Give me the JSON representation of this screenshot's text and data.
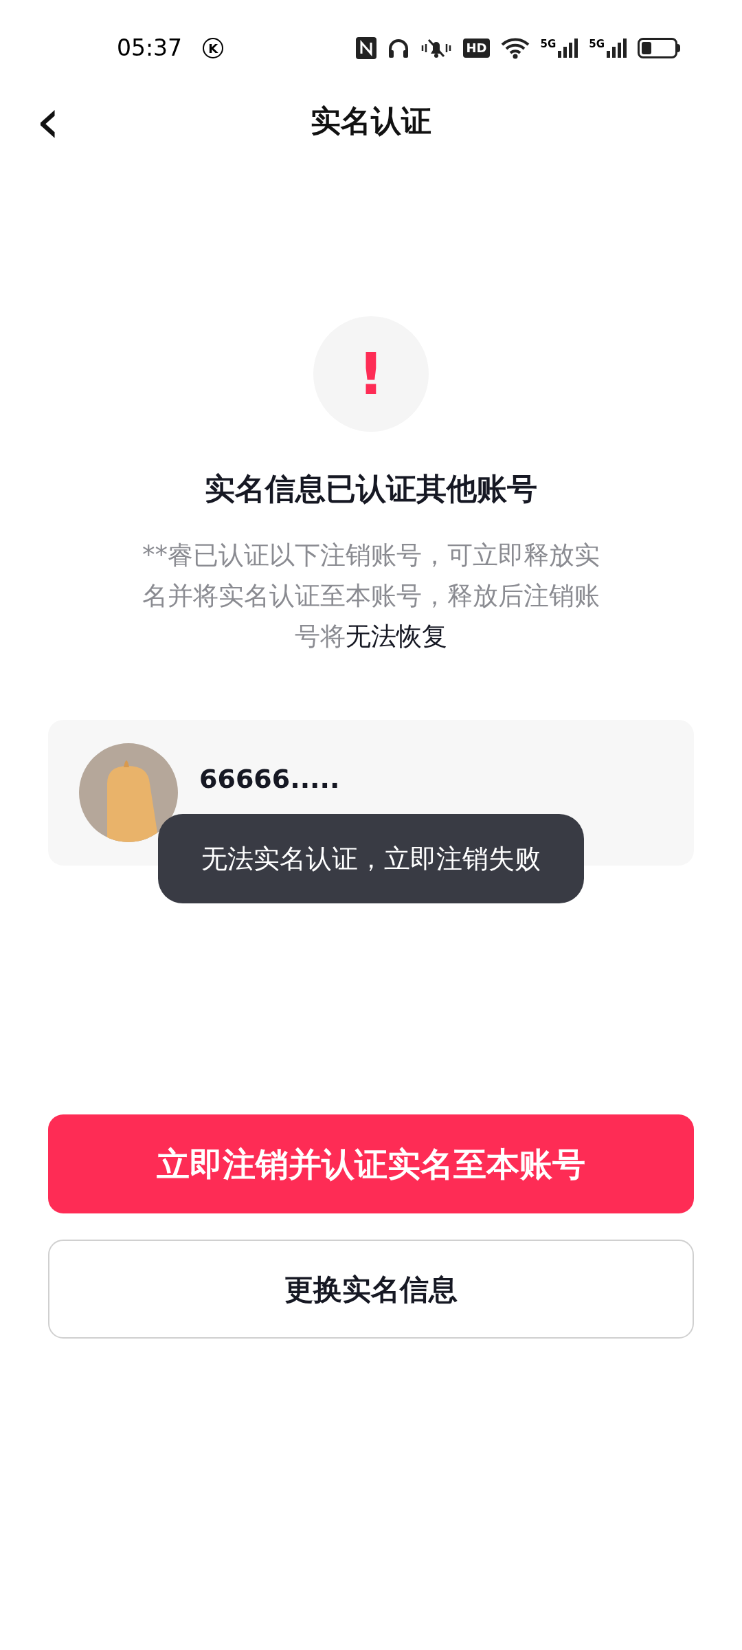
{
  "status_bar": {
    "time": "05:37",
    "badge": "K",
    "hd_label": "HD",
    "network_labels": [
      "5G",
      "5G"
    ]
  },
  "header": {
    "back": "‹",
    "title": "实名认证"
  },
  "alert": {
    "symbol": "!",
    "heading": "实名信息已认证其他账号",
    "notice_text": "**睿已认证以下注销账号，可立即释放实名并将实名认证至本账号，释放后注销账号将",
    "notice_emphasis": "无法恢复"
  },
  "account": {
    "name": "66666....."
  },
  "toast": "无法实名认证，立即注销失败",
  "buttons": [
    {
      "label": "立即注销并认证实名至本账号",
      "kind": "primary"
    },
    {
      "label": "更换实名信息",
      "kind": "outline"
    }
  ]
}
